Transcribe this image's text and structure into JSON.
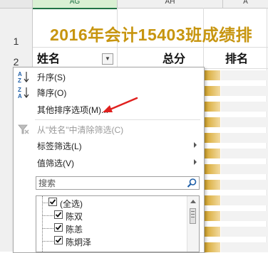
{
  "sheet": {
    "columns": [
      {
        "name": "AG",
        "selected": true
      },
      {
        "name": "AH",
        "selected": false
      },
      {
        "name": "A",
        "selected": false
      }
    ],
    "rows": [
      "1",
      "2"
    ],
    "title": "2016年会计15403班成绩排",
    "headers": {
      "name": "姓名",
      "total": "总分",
      "rank": "排名"
    },
    "colors": {
      "title": "#c7950f",
      "bar": "#d4a52a",
      "selected_column": "#217346"
    }
  },
  "filter_menu": {
    "sort_ascending": "升序(S)",
    "sort_descending": "降序(O)",
    "custom_sort": "其他排序选项(M)...",
    "clear_filter": "从\"姓名\"中清除筛选(C)",
    "label_filter": "标签筛选(L)",
    "value_filter": "值筛选(V)",
    "search_placeholder": "搜索",
    "items": [
      {
        "label": "(全选)",
        "checked": true
      },
      {
        "label": "陈双",
        "checked": true
      },
      {
        "label": "陈恙",
        "checked": true
      },
      {
        "label": "陈炯泽",
        "checked": true
      }
    ]
  },
  "annotation": {
    "arrow_color": "#e0201e",
    "points_to": "custom_sort"
  }
}
